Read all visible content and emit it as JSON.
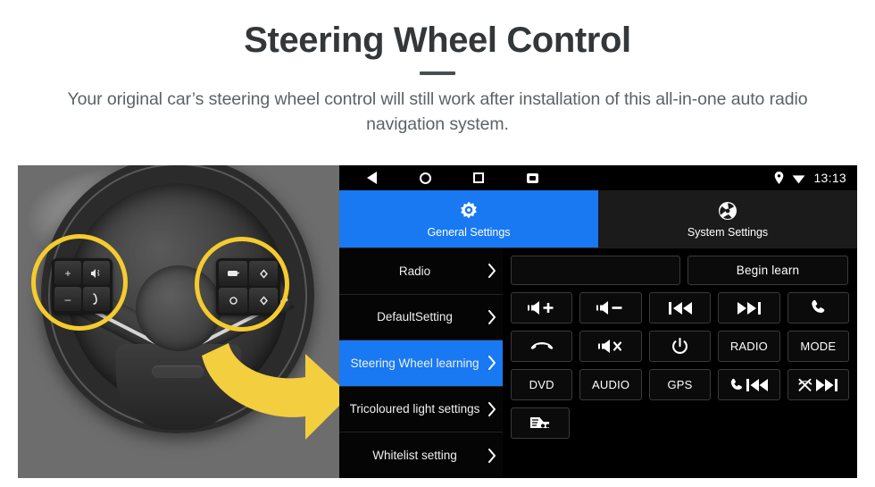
{
  "header": {
    "title": "Steering Wheel Control",
    "subtitle": "Your original car’s steering wheel control will still work after installation of this all-in-one auto radio navigation system."
  },
  "colors": {
    "accent_blue": "#1879F3",
    "highlight_yellow": "#F5CB2E",
    "arrow_yellow": "#F3CE3E",
    "title_gray": "#33373a",
    "subtitle_gray": "#5c6265",
    "unit_black": "#000000"
  },
  "photo": {
    "alt": "Grayscale close-up of a car steering wheel with two yellow circles highlighting the left and right button clusters, and a yellow curved arrow pointing to the head unit screen",
    "left_cluster_buttons": [
      "+",
      "-",
      "voice-assistant",
      "call"
    ],
    "right_cluster_buttons": [
      "source",
      "up-arrow",
      "mode-circle",
      "down-arrow"
    ],
    "highlight_count": 2
  },
  "device": {
    "statusbar": {
      "nav": [
        {
          "name": "back-icon",
          "label": "Back"
        },
        {
          "name": "home-icon",
          "label": "Home"
        },
        {
          "name": "recents-icon",
          "label": "Recents"
        },
        {
          "name": "screenshot-icon",
          "label": "Screenshot"
        }
      ],
      "location_icon": "location-pin-icon",
      "wifi_icon": "wifi-icon",
      "time": "13:13"
    },
    "tabs": [
      {
        "label": "General Settings",
        "icon": "gear-icon",
        "active": true
      },
      {
        "label": "System Settings",
        "icon": "system-icon",
        "active": false
      }
    ],
    "sidebar": [
      {
        "label": "Radio",
        "active": false
      },
      {
        "label": "DefaultSetting",
        "active": false
      },
      {
        "label": "Steering Wheel learning",
        "active": true
      },
      {
        "label": "Tricoloured light settings",
        "active": false
      },
      {
        "label": "Whitelist setting",
        "active": false
      }
    ],
    "controls": {
      "blank_field_value": "",
      "begin_learn_label": "Begin learn",
      "rows": [
        [
          {
            "name": "volume-up-button",
            "icon": "speaker-plus-icon",
            "label": ""
          },
          {
            "name": "volume-down-button",
            "icon": "speaker-minus-icon",
            "label": ""
          },
          {
            "name": "previous-track-button",
            "icon": "previous-track-icon",
            "label": ""
          },
          {
            "name": "next-track-button",
            "icon": "next-track-icon",
            "label": ""
          },
          {
            "name": "call-answer-button",
            "icon": "phone-icon",
            "label": ""
          }
        ],
        [
          {
            "name": "call-end-button",
            "icon": "phone-hangup-icon",
            "label": ""
          },
          {
            "name": "mute-button",
            "icon": "speaker-mute-icon",
            "label": ""
          },
          {
            "name": "power-button",
            "icon": "power-icon",
            "label": ""
          },
          {
            "name": "radio-button",
            "icon": "",
            "label": "RADIO"
          },
          {
            "name": "mode-button",
            "icon": "",
            "label": "MODE"
          }
        ],
        [
          {
            "name": "dvd-button",
            "icon": "",
            "label": "DVD"
          },
          {
            "name": "audio-button",
            "icon": "",
            "label": "AUDIO"
          },
          {
            "name": "gps-button",
            "icon": "",
            "label": "GPS"
          },
          {
            "name": "call-previous-button",
            "icon": "phone-previous-icon",
            "label": ""
          },
          {
            "name": "hangup-next-button",
            "icon": "hangup-next-icon",
            "label": ""
          }
        ],
        [
          {
            "name": "vehicle-info-button",
            "icon": "car-icon",
            "label": ""
          }
        ]
      ]
    }
  }
}
